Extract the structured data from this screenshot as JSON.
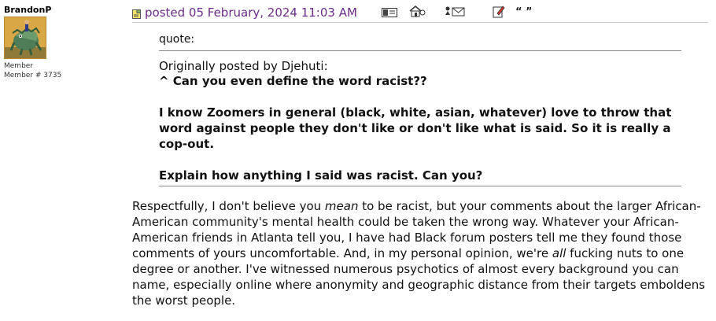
{
  "user": {
    "name": "BrandonP",
    "rank": "Member",
    "member_no": "Member # 3735"
  },
  "post": {
    "date": "posted 05 February, 2024 11:03 AM",
    "tool_icons": [
      "profile-icon",
      "homepage-icon",
      "email-icon",
      "edit-icon",
      "quote-icon"
    ],
    "quote_label": "quote:",
    "quote_origin": "Originally posted by Djehuti:",
    "quote_lines": [
      "^ Can you even define the word racist??",
      "I know Zoomers in general (black, white, asian, whatever) love to throw that word against people they don't like or don't like what is said. So it is really a cop-out.",
      "Explain how anything I said was racist. Can you?"
    ],
    "body": {
      "part1": "Respectfully, I don't believe you ",
      "em1": "mean",
      "part2": " to be racist, but your comments about the larger African-American community's mental health could be taken the wrong way. Whatever your African-American friends in Atlanta tell you, I have had Black forum posters tell me they found those comments of yours uncomfortable. And, in my personal opinion, we're ",
      "em2": "all",
      "part3": " fucking nuts to one degree or another. I've witnessed numerous psychotics of almost every background you can name, especially online where anonymity and geographic distance from their targets emboldens the worst people."
    }
  },
  "colors": {
    "date": "#6b2c8a",
    "rule": "#8a8a8a",
    "avatar_bg": "#d7a441"
  }
}
